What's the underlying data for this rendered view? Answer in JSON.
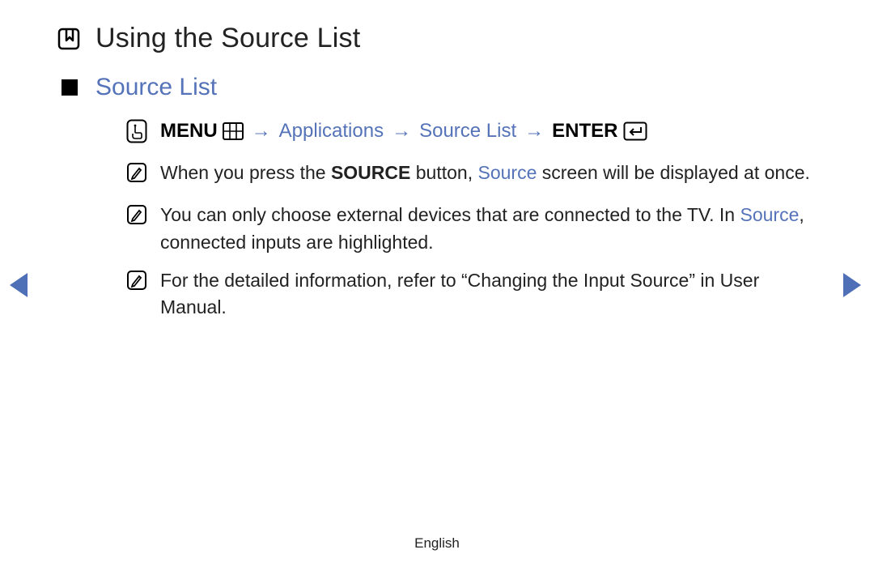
{
  "title": "Using the Source List",
  "section_heading": "Source List",
  "breadcrumb": {
    "menu_label": "MENU",
    "step1": "Applications",
    "step2": "Source List",
    "enter_label": "ENTER",
    "arrow": "→"
  },
  "notes": [
    {
      "pre": "When you press the ",
      "bold1": "SOURCE",
      "mid1": " button, ",
      "blue1": "Source",
      "post": " screen will be displayed at once."
    },
    {
      "pre": "You can only choose external devices that are connected to the TV. In ",
      "blue1": "Source",
      "post": ", connected inputs are highlighted."
    },
    {
      "pre": "For the detailed information, refer to “Changing the Input Source” in User Manual.",
      "post": ""
    }
  ],
  "footer_language": "English"
}
